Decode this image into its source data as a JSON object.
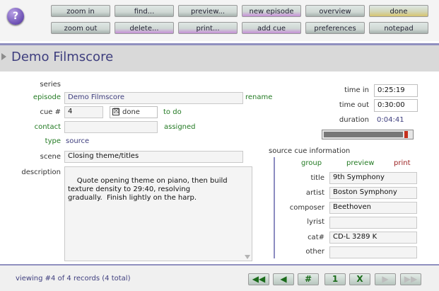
{
  "toolbar": {
    "help_glyph": "?",
    "row1": [
      "zoom in",
      "find...",
      "preview...",
      "new episode",
      "overview",
      "done"
    ],
    "row2": [
      "zoom out",
      "delete...",
      "print...",
      "add cue",
      "preferences",
      "notepad"
    ]
  },
  "header": {
    "title": "Demo Filmscore"
  },
  "form": {
    "series_label": "series",
    "episode_label": "episode",
    "episode_value": "Demo Filmscore",
    "rename_label": "rename",
    "cue_label": "cue #",
    "cue_value": "4",
    "done_mark": "☒",
    "done_label": "done",
    "todo_label": "to do",
    "contact_label": "contact",
    "contact_value": "",
    "assigned_label": "assigned",
    "type_label": "type",
    "type_value": "source",
    "scene_label": "scene",
    "scene_value": "Closing theme/titles",
    "description_label": "description",
    "description_value": "Quote opening theme on piano, then build\ntexture density to 29:40, resolving\ngradually.  Finish lightly on the harp."
  },
  "timing": {
    "time_in_label": "time in",
    "time_in_value": "0:25:19",
    "time_out_label": "time out",
    "time_out_value": "0:30:00",
    "duration_label": "duration",
    "duration_value": "0:04:41",
    "progress_fraction": 0.9,
    "colors": {
      "fill": "#777777",
      "marker": "#c5301d"
    }
  },
  "source_cue": {
    "header": "source cue information",
    "group_label": "group",
    "preview_label": "preview",
    "print_label": "print",
    "title_label": "title",
    "title_value": "9th Symphony",
    "artist_label": "artist",
    "artist_value": "Boston Symphony",
    "composer_label": "composer",
    "composer_value": "Beethoven",
    "lyrist_label": "lyrist",
    "lyrist_value": "",
    "cat_label": "cat#",
    "cat_value": "CD-L 3289 K",
    "other_label": "other",
    "other_value": ""
  },
  "footer": {
    "status": "viewing #4 of 4 records (4 total)",
    "nav": {
      "first": "◀◀",
      "prev": "◀",
      "goto": "#",
      "one": "1",
      "delete": "X",
      "next": "▶",
      "last": "▶▶"
    }
  },
  "colors": {
    "accent": "#3e3e7e",
    "green": "#237a23",
    "red": "#9a1e1e"
  }
}
